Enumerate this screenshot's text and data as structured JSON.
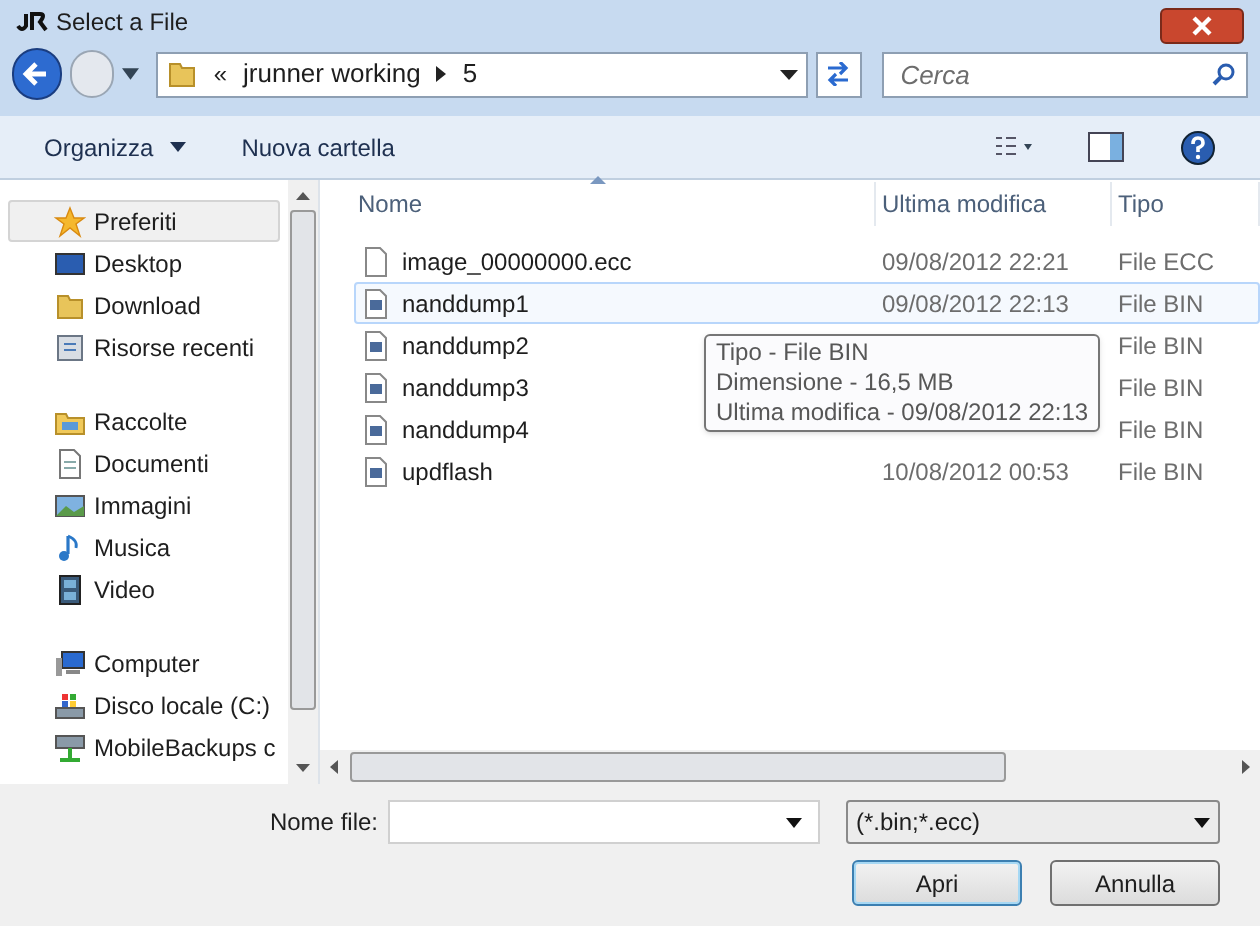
{
  "window": {
    "title": "Select a File"
  },
  "address": {
    "separator": "«",
    "crumbs": [
      {
        "label": "jrunner working"
      },
      {
        "label": "5"
      }
    ]
  },
  "search": {
    "placeholder": "Cerca"
  },
  "toolbar": {
    "buttons": [
      {
        "label": "Organizza",
        "dropdown": true
      },
      {
        "label": "Nuova cartella",
        "dropdown": false
      }
    ]
  },
  "sidebar": {
    "groups": [
      {
        "label": "Preferiti",
        "kind": "star",
        "selected": true,
        "children": [
          {
            "label": "Desktop",
            "kind": "desktop"
          },
          {
            "label": "Download",
            "kind": "folder"
          },
          {
            "label": "Risorse recenti",
            "kind": "recent"
          }
        ]
      },
      {
        "label": "Raccolte",
        "kind": "library",
        "selected": false,
        "children": [
          {
            "label": "Documenti",
            "kind": "document"
          },
          {
            "label": "Immagini",
            "kind": "image"
          },
          {
            "label": "Musica",
            "kind": "music"
          },
          {
            "label": "Video",
            "kind": "video"
          }
        ]
      },
      {
        "label": "Computer",
        "kind": "computer",
        "selected": false,
        "children": [
          {
            "label": "Disco locale (C:)",
            "kind": "drive"
          },
          {
            "label": "MobileBackups c",
            "kind": "network"
          }
        ]
      }
    ]
  },
  "table": {
    "columns": [
      {
        "label": "Nome",
        "sorted": true
      },
      {
        "label": "Ultima modifica",
        "sorted": false
      },
      {
        "label": "Tipo",
        "sorted": false
      }
    ],
    "rows": [
      {
        "name": "image_00000000.ecc",
        "kind": "plain",
        "modified": "09/08/2012 22:21",
        "type": "File ECC",
        "hovered": false
      },
      {
        "name": "nanddump1",
        "kind": "bin",
        "modified": "09/08/2012 22:13",
        "type": "File BIN",
        "hovered": true
      },
      {
        "name": "nanddump2",
        "kind": "bin",
        "type": "File BIN",
        "hovered": false
      },
      {
        "name": "nanddump3",
        "kind": "bin",
        "type": "File BIN",
        "hovered": false
      },
      {
        "name": "nanddump4",
        "kind": "bin",
        "type": "File BIN",
        "hovered": false
      },
      {
        "name": "updflash",
        "kind": "bin",
        "modified": "10/08/2012 00:53",
        "type": "File BIN",
        "hovered": false
      }
    ]
  },
  "tooltip": {
    "lines": [
      "Tipo - File BIN",
      "Dimensione - 16,5 MB",
      "Ultima modifica - 09/08/2012 22:13"
    ]
  },
  "footer": {
    "filename_label": "Nome file:",
    "filter": "(*.bin;*.ecc)",
    "buttons": [
      {
        "label": "Apri",
        "default": true
      },
      {
        "label": "Annulla",
        "default": false
      }
    ]
  }
}
